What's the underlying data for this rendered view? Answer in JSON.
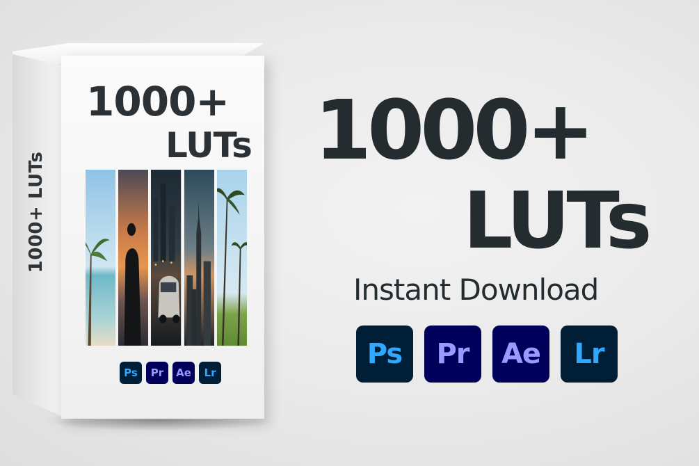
{
  "box": {
    "side_text": "1000+ LUTs",
    "title_line1": "1000+",
    "title_line2": "LUTs"
  },
  "hero": {
    "title_line1": "1000+",
    "title_line2": "LUTs",
    "subtitle": "Instant Download"
  },
  "apps": [
    {
      "label": "Ps",
      "bg": "#001e36",
      "fg": "#31a8ff",
      "icon": "photoshop-icon"
    },
    {
      "label": "Pr",
      "bg": "#00005b",
      "fg": "#9999ff",
      "icon": "premiere-pro-icon"
    },
    {
      "label": "Ae",
      "bg": "#00005b",
      "fg": "#9999ff",
      "icon": "after-effects-icon"
    },
    {
      "label": "Lr",
      "bg": "#001e36",
      "fg": "#31a8ff",
      "icon": "lightroom-icon"
    }
  ]
}
